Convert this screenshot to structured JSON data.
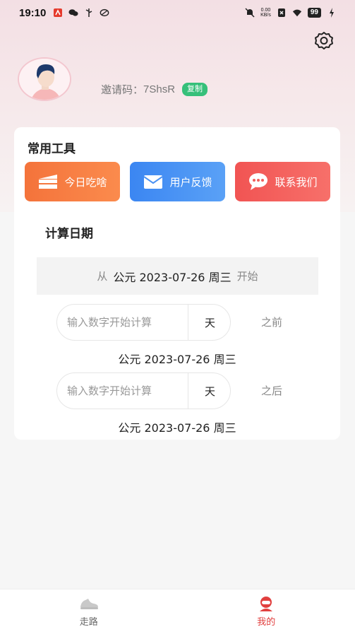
{
  "status_bar": {
    "time": "19:10",
    "net_speed_value": "0.00",
    "net_speed_unit": "KB/s",
    "battery": "99"
  },
  "header": {
    "settings_icon": "gear-icon",
    "invite_label": "邀请码：",
    "invite_code": "7ShsR",
    "copy_label": "复制"
  },
  "tools": {
    "title": "常用工具",
    "items": [
      {
        "label": "今日吃啥",
        "icon": "cake-icon"
      },
      {
        "label": "用户反馈",
        "icon": "mail-icon"
      },
      {
        "label": "联系我们",
        "icon": "chat-icon"
      }
    ]
  },
  "calc": {
    "title": "计算日期",
    "from_prefix": "从",
    "from_date": "公元 2023-07-26 周三",
    "from_suffix": "开始",
    "before": {
      "placeholder": "输入数字开始计算",
      "unit": "天",
      "direction": "之前",
      "result": "公元 2023-07-26 周三"
    },
    "after": {
      "placeholder": "输入数字开始计算",
      "unit": "天",
      "direction": "之后",
      "result": "公元 2023-07-26 周三"
    }
  },
  "tabbar": {
    "tabs": [
      {
        "label": "走路",
        "icon": "shoe-icon",
        "active": false
      },
      {
        "label": "我的",
        "icon": "user-icon",
        "active": true
      }
    ],
    "active_color": "#e1403f"
  }
}
